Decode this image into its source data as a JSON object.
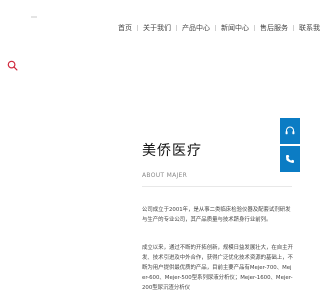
{
  "header": {
    "nav": [
      {
        "label": "首页"
      },
      {
        "label": "关于我们"
      },
      {
        "label": "产品中心"
      },
      {
        "label": "新闻中心"
      },
      {
        "label": "售后服务"
      },
      {
        "label": "联系我们"
      }
    ]
  },
  "icons": {
    "search": "search-icon",
    "side": [
      "headset-icon",
      "phone-icon"
    ]
  },
  "colors": {
    "accent": "#0b7cc4",
    "search_icon": "#d0283c"
  },
  "about": {
    "title": "美侨医疗",
    "subtitle": "ABOUT MAJER",
    "paragraphs": [
      "公司成立于2001年，是从事二类临床检验仪器及配套试剂研发与生产的专业公司，其产品质量与技术跻身行业前列。",
      "成立以来，通过不断的开拓创新，规模日益发展壮大，在自主开发、技术引进及中外合作，获得广泛优化技术资源的基础上，不断为用户提供最优质的产品，目前主要产品有Mejer-700、Mejer-600、Mejer-500型系列尿液分析仪；Mejer-1600、Mejer-200型尿沉渣分析仪"
    ]
  }
}
